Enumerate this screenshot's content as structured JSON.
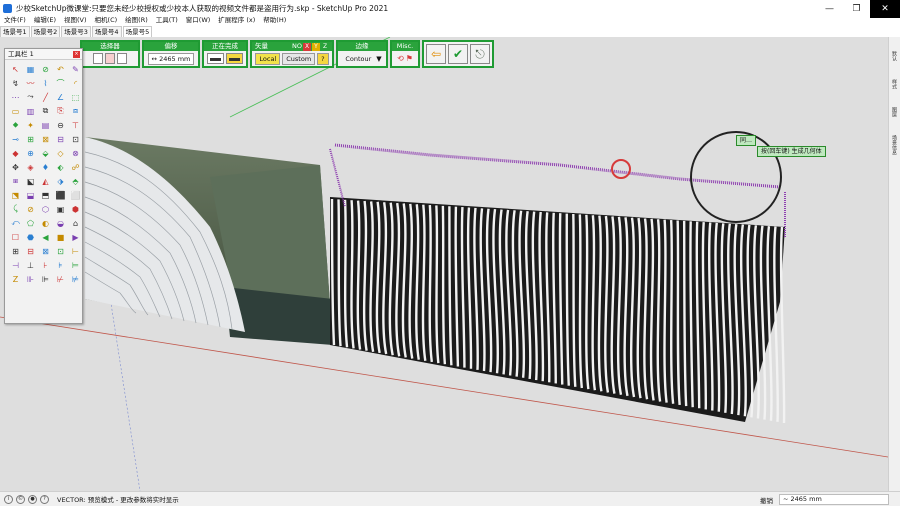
{
  "window": {
    "title": "少校SketchUp微课堂:只要您未经少校授权或少校本人获取的视频文件都是盗用行为.skp - SketchUp Pro 2021",
    "minimize": "—",
    "maximize": "❐",
    "close": "✕"
  },
  "menu": [
    "文件(F)",
    "编辑(E)",
    "视图(V)",
    "相机(C)",
    "绘图(R)",
    "工具(T)",
    "窗口(W)",
    "扩展程序 (x)",
    "帮助(H)"
  ],
  "scenes": [
    "场景号1",
    "场景号2",
    "场景号3",
    "场景号4",
    "场景号5"
  ],
  "vector_toolbar": {
    "select_label": "选择器",
    "offset_label": "偏移",
    "offset_value": "↔ 2465 mm",
    "progress_label": "正在完成",
    "vector_label": "矢量",
    "no_label": "NO",
    "axis_x": "X",
    "axis_y": "Y",
    "axis_z": "Z",
    "local_label": "Local",
    "custom_label": "Custom",
    "help_label": "?",
    "edge_label": "边缘",
    "edge_value": "Contour",
    "misc_label": "Misc."
  },
  "toolbox": {
    "title": "工具栏 1",
    "close": "×",
    "tools": [
      "↖",
      "▦",
      "⊘",
      "↶",
      "✎",
      "↯",
      "〰",
      "⌇",
      "⌒",
      "◜",
      "⋯",
      "⤳",
      "╱",
      "∠",
      "⬚",
      "▭",
      "▥",
      "⧉",
      "⎘",
      "⧈",
      "⬥",
      "✦",
      "▤",
      "⊖",
      "⊤",
      "⊸",
      "⊞",
      "⊠",
      "⊟",
      "⊡",
      "◆",
      "⊕",
      "⬙",
      "◇",
      "⊗",
      "✥",
      "◈",
      "♦",
      "⬖",
      "☍",
      "⧆",
      "⬕",
      "◭",
      "⬗",
      "⬘",
      "⬔",
      "⬓",
      "⬒",
      "⬛",
      "⬜",
      "⤹",
      "⊘",
      "⬡",
      "▣",
      "⬢",
      "⤺",
      "⬠",
      "◐",
      "◒",
      "⌂",
      "☐",
      "⬣",
      "◀",
      "■",
      "▶",
      "⊞",
      "⊟",
      "⊠",
      "⊡",
      "⊢",
      "⊣",
      "⊥",
      "⊦",
      "⊧",
      "⊨",
      "Z",
      "⊪",
      "⊫",
      "⊬",
      "⊭"
    ]
  },
  "tooltips": {
    "line1": "同…",
    "line2": "按(回车键) 生成几何体"
  },
  "sidepanel": [
    "默认",
    "样式",
    "图层",
    "场景信息"
  ],
  "status": {
    "text": "VECTOR: 预览模式 - 更改参数将实时显示",
    "measure_label": "撤销",
    "measure_value": "~ 2465 mm"
  },
  "colors": {
    "toolbar_green": "#2aa33c",
    "active_yellow": "#f2e24b",
    "viewport_bg": "#dedede",
    "fin_purple": "#8e3fb0"
  }
}
